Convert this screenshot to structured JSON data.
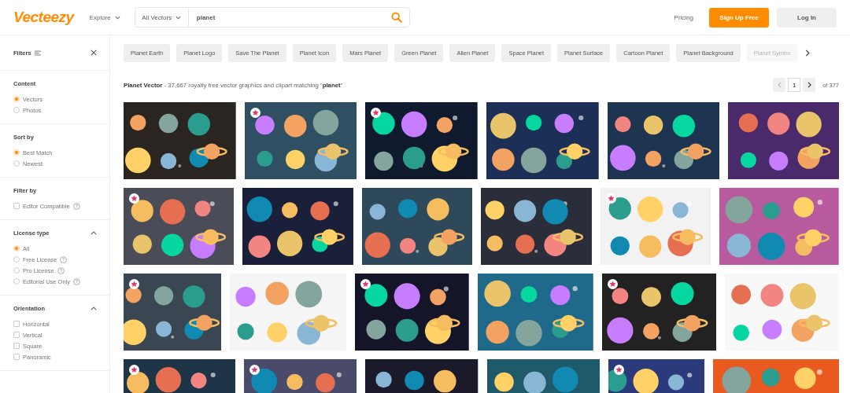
{
  "header": {
    "logo": "Vecteezy",
    "explore": "Explore",
    "search": {
      "category": "All Vectors",
      "value": "planet"
    },
    "pricing": "Pricing",
    "signup": "Sign Up Free",
    "login": "Log In"
  },
  "sidebar": {
    "title": "Filters",
    "sections": [
      {
        "title": "Content",
        "kind": "radio",
        "options": [
          {
            "label": "Vectors",
            "selected": true,
            "help": false
          },
          {
            "label": "Photos",
            "selected": false,
            "help": false
          }
        ]
      },
      {
        "title": "Sort by",
        "kind": "radio",
        "options": [
          {
            "label": "Best Match",
            "selected": true,
            "help": false
          },
          {
            "label": "Newest",
            "selected": false,
            "help": false
          }
        ]
      },
      {
        "title": "Filter by",
        "kind": "checkbox",
        "options": [
          {
            "label": "Editor Compatible",
            "checked": false,
            "help": true
          }
        ]
      },
      {
        "title": "License type",
        "kind": "radio",
        "expanded": true,
        "options": [
          {
            "label": "All",
            "selected": true,
            "help": false
          },
          {
            "label": "Free License",
            "selected": false,
            "help": true
          },
          {
            "label": "Pro License",
            "selected": false,
            "help": true
          },
          {
            "label": "Editorial Use Only",
            "selected": false,
            "help": true
          }
        ]
      },
      {
        "title": "Orientation",
        "kind": "checkbox",
        "expanded": true,
        "options": [
          {
            "label": "Horizontal",
            "checked": false,
            "help": false
          },
          {
            "label": "Vertical",
            "checked": false,
            "help": false
          },
          {
            "label": "Square",
            "checked": false,
            "help": false
          },
          {
            "label": "Panoramic",
            "checked": false,
            "help": false
          }
        ]
      }
    ]
  },
  "tags": [
    {
      "label": "Planet Earth",
      "faded": false
    },
    {
      "label": "Planet Logo",
      "faded": false
    },
    {
      "label": "Save The Planet",
      "faded": false
    },
    {
      "label": "Planet Icon",
      "faded": false
    },
    {
      "label": "Mars Planet",
      "faded": false
    },
    {
      "label": "Green Planet",
      "faded": false
    },
    {
      "label": "Alien Planet",
      "faded": false
    },
    {
      "label": "Space Planet",
      "faded": false
    },
    {
      "label": "Planet Surface",
      "faded": false
    },
    {
      "label": "Cartoon Planet",
      "faded": false
    },
    {
      "label": "Planet Background",
      "faded": false
    },
    {
      "label": "Planet Symbo",
      "faded": true
    }
  ],
  "results": {
    "summary": "**Planet Vector** - 37,667 royalty free vector graphics and clipart matching “**planet**”",
    "page": "1",
    "of": "of 377",
    "rows": [
      {
        "images": [
          {
            "kind": "picture",
            "badge": false
          },
          {
            "kind": "picture",
            "badge": true
          },
          {
            "kind": "picture",
            "badge": true
          },
          {
            "kind": "picture",
            "badge": false
          },
          {
            "kind": "picture",
            "badge": false
          },
          {
            "kind": "picture",
            "badge": false
          }
        ]
      },
      {
        "images": [
          {
            "kind": "picture",
            "badge": true
          },
          {
            "kind": "picture",
            "badge": false
          },
          {
            "kind": "picture",
            "badge": false
          },
          {
            "kind": "picture",
            "badge": false
          },
          {
            "kind": "picture",
            "badge": true
          },
          {
            "kind": "picture",
            "badge": false
          }
        ]
      },
      {
        "images": [
          {
            "kind": "picture",
            "badge": true
          },
          {
            "kind": "picture",
            "badge": false
          },
          {
            "kind": "picture",
            "badge": true
          },
          {
            "kind": "picture",
            "badge": false
          },
          {
            "kind": "picture",
            "badge": true
          },
          {
            "kind": "picture",
            "badge": false
          }
        ]
      },
      {
        "images": [
          {
            "kind": "picture",
            "badge": true
          },
          {
            "kind": "picture",
            "badge": true
          },
          {
            "kind": "picture",
            "badge": false
          },
          {
            "kind": "picture",
            "badge": false
          },
          {
            "kind": "picture",
            "badge": true
          },
          {
            "kind": "picture",
            "badge": false
          }
        ]
      }
    ]
  }
}
